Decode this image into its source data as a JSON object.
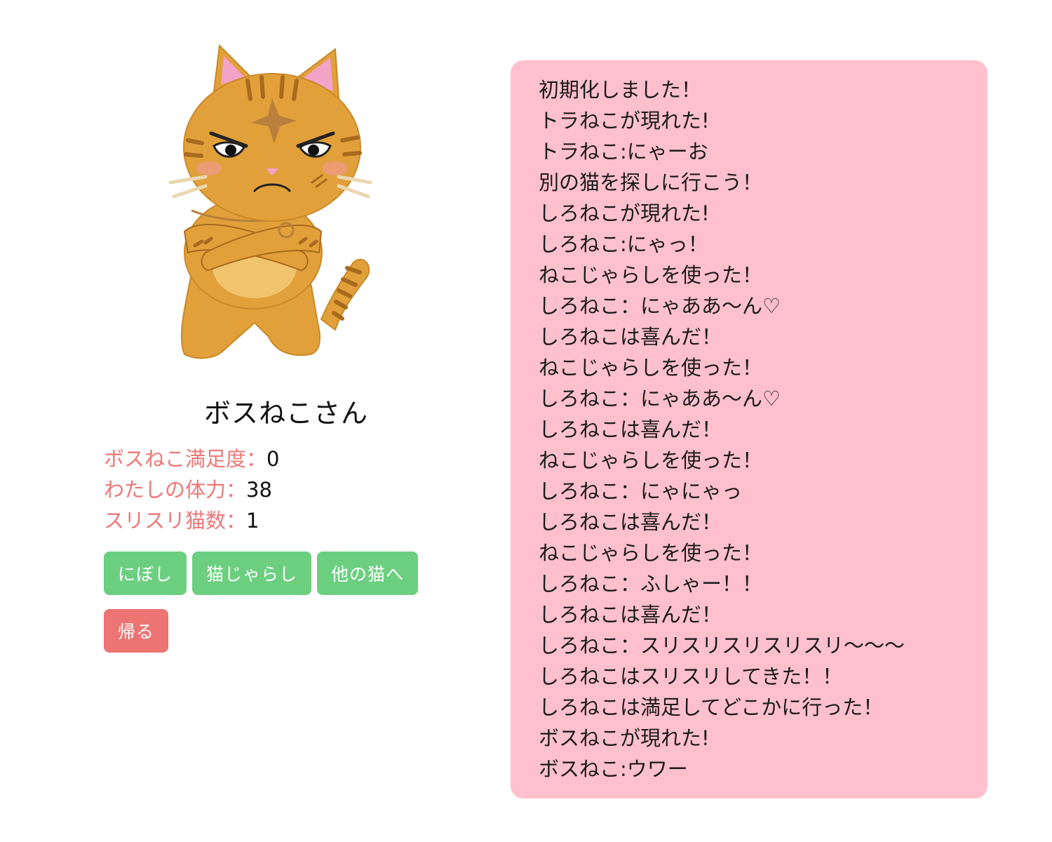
{
  "cat": {
    "name": "ボスねこさん",
    "image_icon": "boss-tabby-cat-illustration"
  },
  "stats": [
    {
      "label": "ボスねこ満足度：",
      "value": "0"
    },
    {
      "label": "わたしの体力：",
      "value": "38"
    },
    {
      "label": "スリスリ猫数：",
      "value": "1"
    }
  ],
  "buttons": {
    "niboshi": "にぼし",
    "nekojarashi": "猫じゃらし",
    "next_cat": "他の猫へ",
    "go_home": "帰る"
  },
  "log": [
    "初期化しました！",
    "トラねこが現れた!",
    "トラねこ:にゃーお",
    "別の猫を探しに行こう！",
    "しろねこが現れた!",
    "しろねこ:にゃっ！",
    "ねこじゃらしを使った！",
    "しろねこ：にゃああ〜ん♡",
    "しろねこは喜んだ！",
    "ねこじゃらしを使った！",
    "しろねこ：にゃああ〜ん♡",
    "しろねこは喜んだ！",
    "ねこじゃらしを使った！",
    "しろねこ：にゃにゃっ",
    "しろねこは喜んだ！",
    "ねこじゃらしを使った！",
    "しろねこ：ふしゃー！！",
    "しろねこは喜んだ！",
    "しろねこ：スリスリスリスリスリ〜〜〜",
    "しろねこはスリスリしてきた！！",
    "しろねこは満足してどこかに行った！",
    "ボスねこが現れた!",
    "ボスねこ:ウワー"
  ],
  "colors": {
    "label": "#ee7777",
    "button_green": "#6ccf80",
    "button_red": "#ec7472",
    "log_background": "#ffc0cd",
    "cat_fur": "#e1a03a"
  }
}
